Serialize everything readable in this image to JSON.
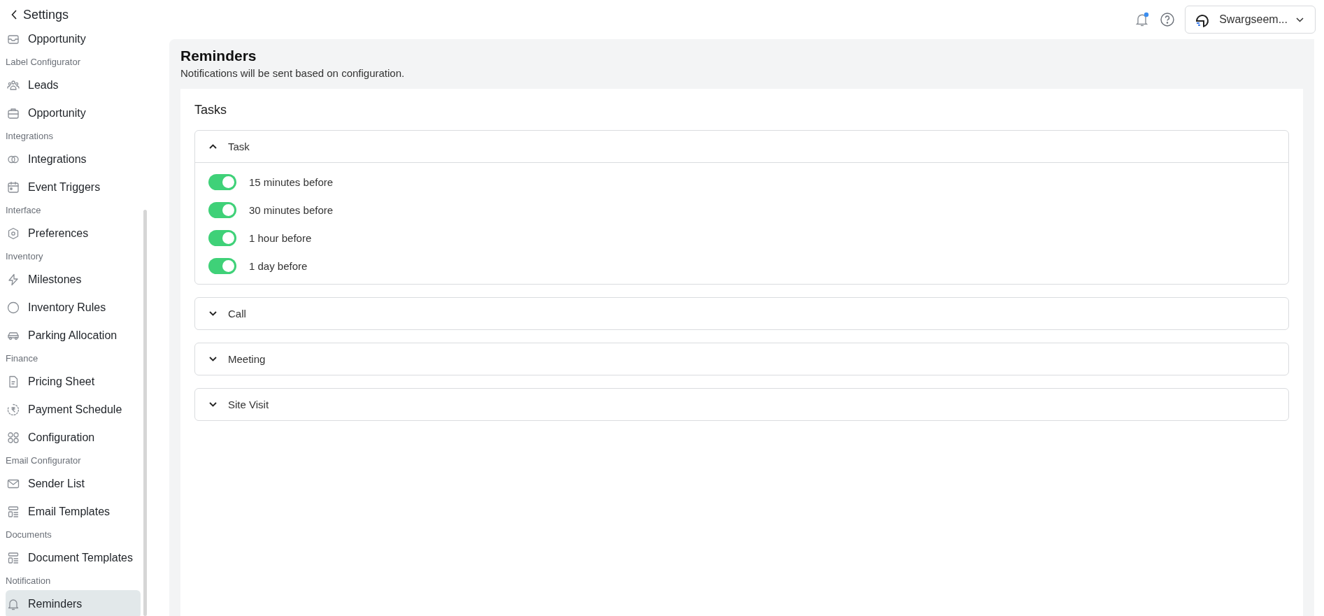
{
  "header": {
    "back_label": "Settings",
    "notifications": {
      "unread": true
    },
    "workspace": "Swargseem..."
  },
  "sidebar": {
    "items": [
      {
        "kind": "item",
        "label": "Opportunity",
        "selected": false
      },
      {
        "kind": "section",
        "label": "Label Configurator"
      },
      {
        "kind": "item",
        "label": "Leads",
        "selected": false
      },
      {
        "kind": "item",
        "label": "Opportunity",
        "selected": false
      },
      {
        "kind": "section",
        "label": "Integrations"
      },
      {
        "kind": "item",
        "label": "Integrations",
        "selected": false
      },
      {
        "kind": "item",
        "label": "Event Triggers",
        "selected": false
      },
      {
        "kind": "section",
        "label": "Interface"
      },
      {
        "kind": "item",
        "label": "Preferences",
        "selected": false
      },
      {
        "kind": "section",
        "label": "Inventory"
      },
      {
        "kind": "item",
        "label": "Milestones",
        "selected": false
      },
      {
        "kind": "item",
        "label": "Inventory Rules",
        "selected": false
      },
      {
        "kind": "item",
        "label": "Parking Allocation",
        "selected": false
      },
      {
        "kind": "section",
        "label": "Finance"
      },
      {
        "kind": "item",
        "label": "Pricing Sheet",
        "selected": false
      },
      {
        "kind": "item",
        "label": "Payment Schedule",
        "selected": false
      },
      {
        "kind": "item",
        "label": "Configuration",
        "selected": false
      },
      {
        "kind": "section",
        "label": "Email Configurator"
      },
      {
        "kind": "item",
        "label": "Sender List",
        "selected": false
      },
      {
        "kind": "item",
        "label": "Email Templates",
        "selected": false
      },
      {
        "kind": "section",
        "label": "Documents"
      },
      {
        "kind": "item",
        "label": "Document Templates",
        "selected": false
      },
      {
        "kind": "section",
        "label": "Notification"
      },
      {
        "kind": "item",
        "label": "Reminders",
        "selected": true
      }
    ]
  },
  "page": {
    "title": "Reminders",
    "subtitle": "Notifications will be sent based on configuration."
  },
  "card": {
    "title": "Tasks",
    "groups": [
      {
        "label": "Task",
        "expanded": true,
        "options": [
          {
            "label": "15 minutes before",
            "on": true
          },
          {
            "label": "30 minutes before",
            "on": true
          },
          {
            "label": "1 hour before",
            "on": true
          },
          {
            "label": "1 day before",
            "on": true
          }
        ]
      },
      {
        "label": "Call",
        "expanded": false
      },
      {
        "label": "Meeting",
        "expanded": false
      },
      {
        "label": "Site Visit",
        "expanded": false
      }
    ]
  }
}
